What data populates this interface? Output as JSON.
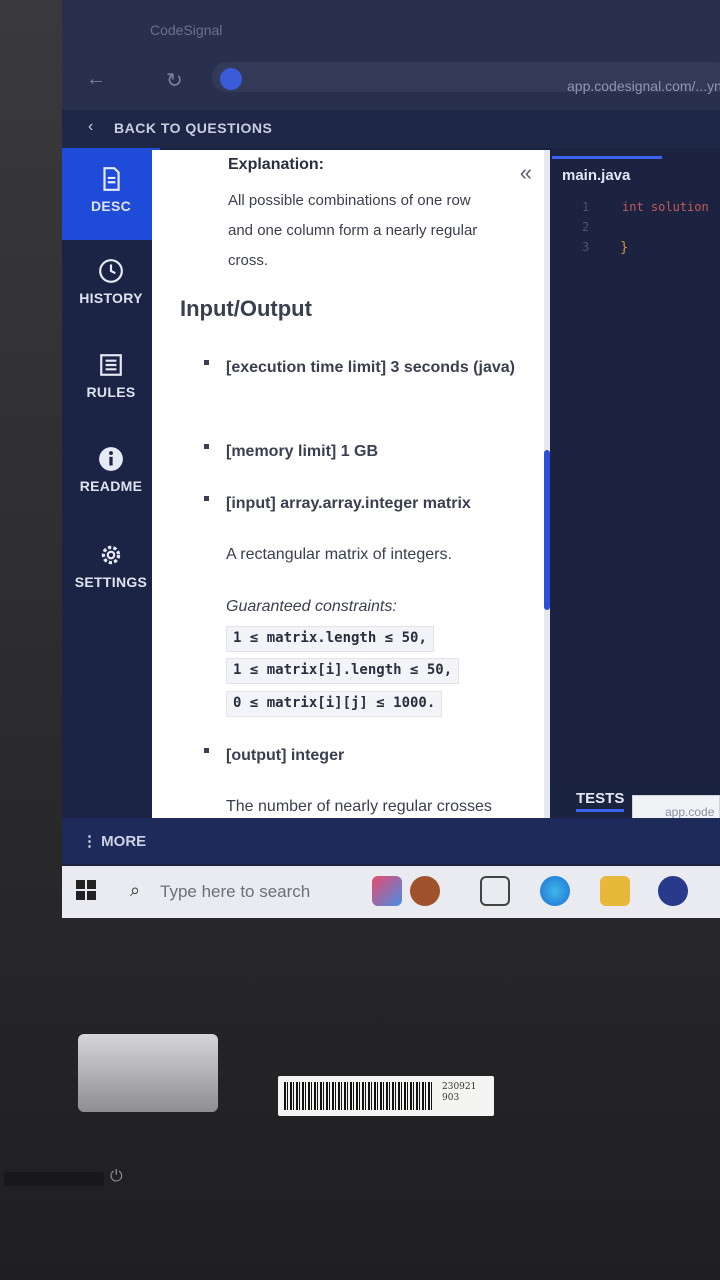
{
  "browser": {
    "tab_title": "CodeSignal",
    "url": "app.codesignal.com/...ynWe/question/owNd"
  },
  "back_label": "BACK TO QUESTIONS",
  "sidebar": {
    "items": [
      {
        "label": "DESC",
        "icon": "document-icon",
        "active": true
      },
      {
        "label": "HISTORY",
        "icon": "clock-icon",
        "active": false
      },
      {
        "label": "RULES",
        "icon": "list-icon",
        "active": false
      },
      {
        "label": "README",
        "icon": "info-icon",
        "active": false
      },
      {
        "label": "SETTINGS",
        "icon": "gear-icon",
        "active": false
      }
    ]
  },
  "description": {
    "explanation_title": "Explanation:",
    "explanation_lines": [
      "All possible combinations of one row",
      "and one column form a nearly regular",
      "cross."
    ],
    "section_heading": "Input/Output",
    "time_limit": "[execution time limit] 3 seconds (java)",
    "memory_limit": "[memory limit] 1 GB",
    "input": "[input] array.array.integer matrix",
    "input_desc": "A rectangular matrix of integers.",
    "constraints_title": "Guaranteed constraints:",
    "constraints": [
      "1 ≤ matrix.length ≤ 50",
      "1 ≤ matrix[i].length ≤ 50",
      "0 ≤ matrix[i][j] ≤ 1000"
    ],
    "constraint_separators": [
      ",",
      ",",
      "."
    ],
    "output": "[output] integer",
    "output_desc": "The number of nearly regular crosses"
  },
  "editor": {
    "filename": "main.java",
    "line_numbers": [
      "1",
      "2",
      "3"
    ],
    "code_line_1": "int solution",
    "code_line_3": "}"
  },
  "tests_label": "TESTS",
  "popup_text": "app.code",
  "more_label": "MORE",
  "taskbar": {
    "search_placeholder": "Type here to search"
  },
  "barcode_number": "230921 903",
  "colors": {
    "accent": "#1e4bd8",
    "sidebar_bg": "#1c2446",
    "editor_bg": "#1b2340"
  }
}
